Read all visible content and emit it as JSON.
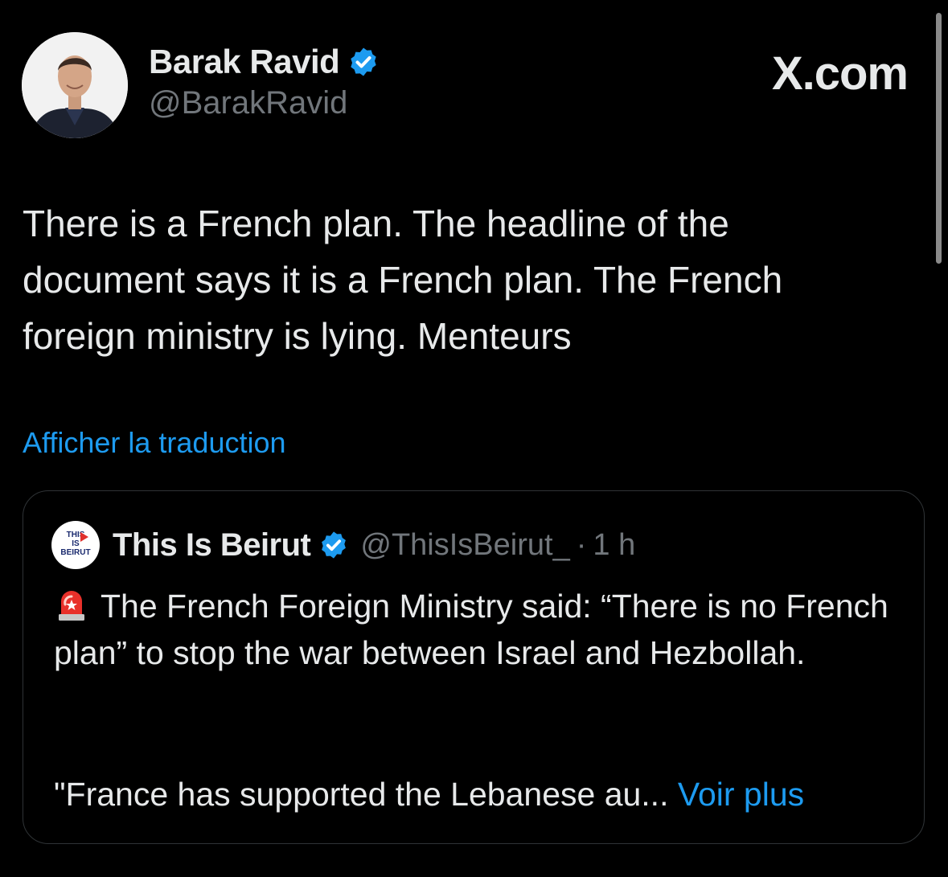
{
  "author": {
    "name": "Barak Ravid",
    "handle": "@BarakRavid",
    "verified": true,
    "avatar_icon": "profile-photo"
  },
  "brand": "X.com",
  "tweet": {
    "text": "There is a French plan. The headline of the document says it is a French plan. The French foreign ministry is lying. Menteurs",
    "translate_label": "Afficher la traduction"
  },
  "quoted_tweet": {
    "avatar_label_line1": "THIS",
    "avatar_label_line2": "IS",
    "avatar_label_line3": "BEIRUT",
    "name": "This Is Beirut",
    "handle": "@ThisIsBeirut_",
    "separator": "·",
    "time": "1 h",
    "verified": true,
    "emoji_icon": "rotating-light-icon",
    "text": "The French Foreign Ministry said: “There is no French plan” to stop the war between Israel and Hezbollah.",
    "excerpt": "\"France has supported the Lebanese au...",
    "more_label": "Voir plus"
  },
  "colors": {
    "background": "#000000",
    "text": "#e7e9ea",
    "secondary": "#71767b",
    "accent": "#1d9bf0",
    "border": "#2f3336"
  }
}
